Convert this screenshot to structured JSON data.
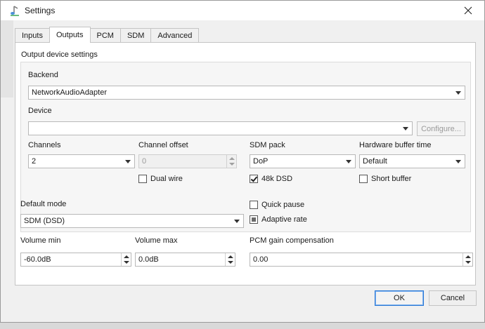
{
  "window": {
    "title": "Settings"
  },
  "tabs": [
    {
      "label": "Inputs",
      "active": false
    },
    {
      "label": "Outputs",
      "active": true
    },
    {
      "label": "PCM",
      "active": false
    },
    {
      "label": "SDM",
      "active": false
    },
    {
      "label": "Advanced",
      "active": false
    }
  ],
  "output": {
    "section_title": "Output device settings",
    "backend": {
      "label": "Backend",
      "value": "NetworkAudioAdapter"
    },
    "device": {
      "label": "Device",
      "value": "",
      "configure_label": "Configure..."
    },
    "channels": {
      "label": "Channels",
      "value": "2"
    },
    "channel_offset": {
      "label": "Channel offset",
      "value": "0"
    },
    "sdm_pack": {
      "label": "SDM pack",
      "value": "DoP"
    },
    "hardware_buffer_time": {
      "label": "Hardware buffer time",
      "value": "Default"
    },
    "dual_wire": {
      "label": "Dual wire",
      "checked": false
    },
    "dsd_48k": {
      "label": "48k DSD",
      "checked": true
    },
    "short_buffer": {
      "label": "Short buffer",
      "checked": false
    }
  },
  "default_mode": {
    "label": "Default mode",
    "value": "SDM (DSD)"
  },
  "quick_pause": {
    "label": "Quick pause",
    "checked": false
  },
  "adaptive_rate": {
    "label": "Adaptive rate",
    "state": "partial"
  },
  "volume_min": {
    "label": "Volume min",
    "value": "-60.0dB"
  },
  "volume_max": {
    "label": "Volume max",
    "value": "0.0dB"
  },
  "pcm_gain": {
    "label": "PCM gain compensation",
    "value": "0.00"
  },
  "footer": {
    "ok_label": "OK",
    "cancel_label": "Cancel"
  }
}
